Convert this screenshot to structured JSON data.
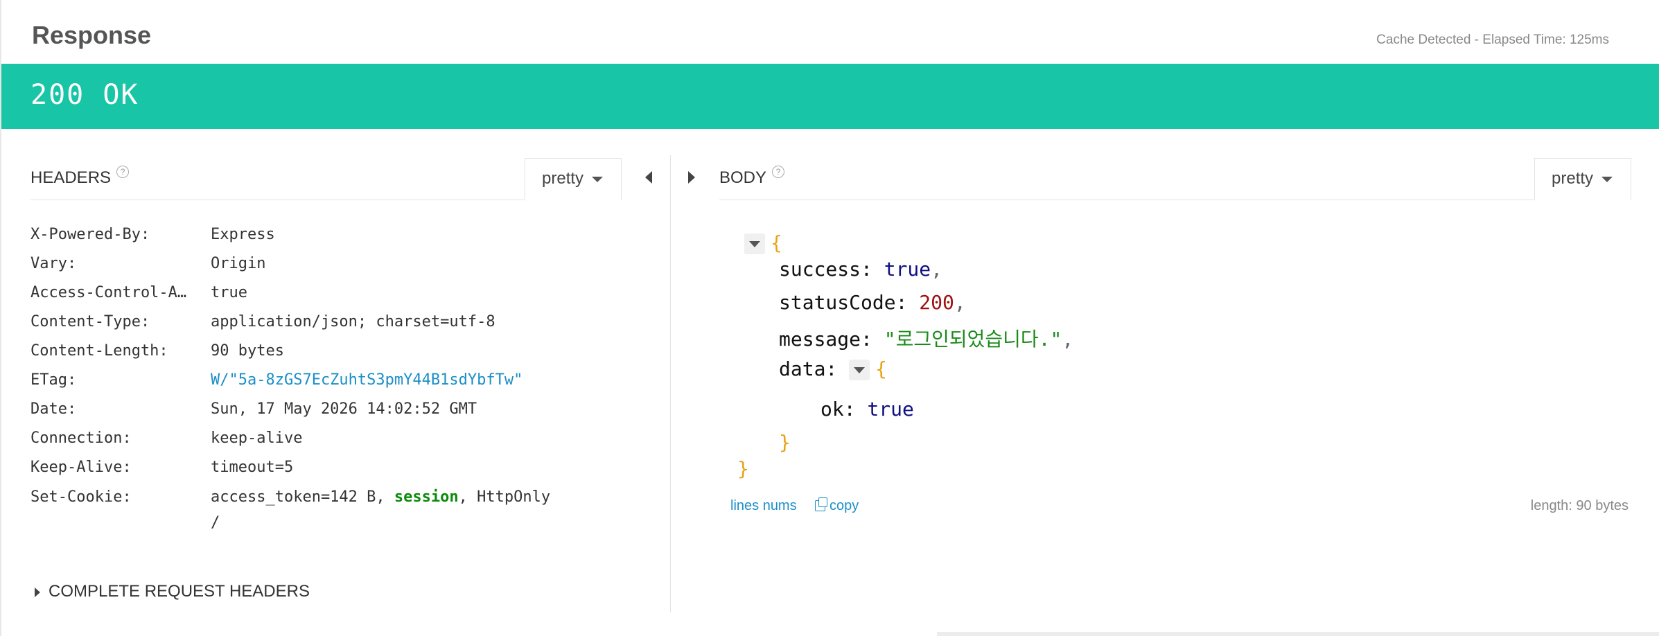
{
  "response": {
    "title": "Response",
    "meta": "Cache Detected -  Elapsed Time: 125ms",
    "status": "200 OK",
    "status_color": "#18c5a6"
  },
  "headers": {
    "title": "HEADERS",
    "help": "?",
    "format": "pretty",
    "rows": [
      {
        "name": "X-Powered-By:",
        "value": "Express"
      },
      {
        "name": "Vary:",
        "value": "Origin"
      },
      {
        "name": "Access-Control-A…",
        "value": "true"
      },
      {
        "name": "Content-Type:",
        "value": "application/json; charset=utf-8"
      },
      {
        "name": "Content-Length:",
        "value": "90 bytes"
      },
      {
        "name": "ETag:",
        "value": "W/\"5a-8zGS7EcZuhtS3pmY44B1sdYbfTw\""
      },
      {
        "name": "Date:",
        "value": "Sun, 17 May 2026 14:02:52 GMT"
      },
      {
        "name": "Connection:",
        "value": "keep-alive"
      },
      {
        "name": "Keep-Alive:",
        "value": "timeout=5"
      }
    ],
    "set_cookie": {
      "name": "Set-Cookie:",
      "value_prefix": "access_token=142 B, ",
      "value_session": "session",
      "value_suffix": ", HttpOnly",
      "value_line2": "/"
    },
    "complete_label": "COMPLETE REQUEST HEADERS"
  },
  "body": {
    "title": "BODY",
    "help": "?",
    "format": "pretty",
    "json": {
      "open": "{",
      "close": "}",
      "lines": {
        "success_key": "success:",
        "success_val": "true",
        "status_key": "statusCode:",
        "status_val": "200",
        "message_key": "message:",
        "message_val": "\"로그인되었습니다.\"",
        "data_key": "data:",
        "ok_key": "ok:",
        "ok_val": "true"
      },
      "comma": ","
    },
    "lines_nums": "lines nums",
    "copy": "copy",
    "length": "length: 90 bytes"
  }
}
